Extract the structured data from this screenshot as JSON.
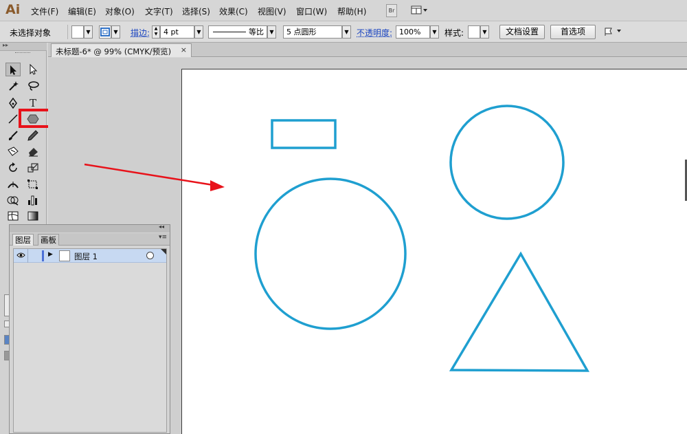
{
  "app": {
    "logo": "Ai"
  },
  "menu": {
    "items": [
      "文件(F)",
      "编辑(E)",
      "对象(O)",
      "文字(T)",
      "选择(S)",
      "效果(C)",
      "视图(V)",
      "窗口(W)",
      "帮助(H)"
    ],
    "bridge_label": "Br"
  },
  "control_bar": {
    "selection_status": "未选择对象",
    "stroke_label": "描边:",
    "stroke_weight": "4 pt",
    "stroke_profile": "等比",
    "brush": "5 点圆形",
    "opacity_label": "不透明度:",
    "opacity_value": "100%",
    "style_label": "样式:",
    "doc_setup_button": "文档设置",
    "preferences_button": "首选项"
  },
  "document": {
    "tab_title": "未标题-6* @ 99% (CMYK/预览)",
    "close_glyph": "×"
  },
  "tools": [
    "selection-tool",
    "direct-selection-tool",
    "magic-wand-tool",
    "lasso-tool",
    "pen-tool",
    "type-tool",
    "line-segment-tool",
    "polygon-tool",
    "paintbrush-tool",
    "pencil-tool",
    "blob-brush-tool",
    "eraser-tool",
    "rotate-tool",
    "scale-tool",
    "width-tool",
    "free-transform-tool",
    "shape-builder-tool",
    "graph-tool",
    "mesh-tool",
    "gradient-tool"
  ],
  "layers_panel": {
    "tabs": [
      "图层",
      "画板"
    ],
    "active_tab": "图层",
    "layers": [
      {
        "name": "图层 1",
        "visible": true
      }
    ]
  },
  "artwork": {
    "stroke_color": "#1f9fd0",
    "shapes": [
      "rectangle",
      "circle",
      "circle",
      "triangle"
    ]
  },
  "annotations": {
    "highlight_color": "#e8121a",
    "arrow_color": "#e8121a"
  }
}
